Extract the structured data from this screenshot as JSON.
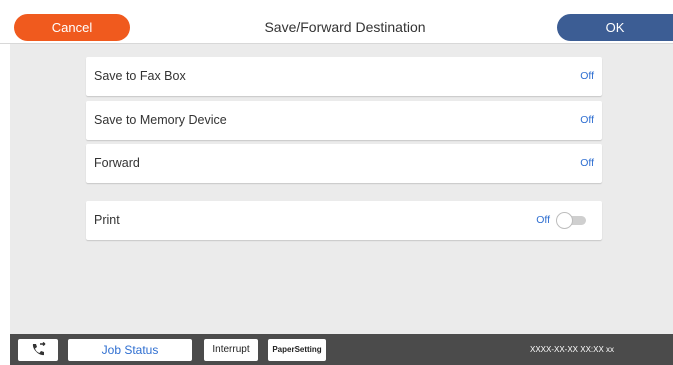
{
  "header": {
    "cancel_label": "Cancel",
    "title": "Save/Forward Destination",
    "ok_label": "OK"
  },
  "settings": [
    {
      "label": "Save to Fax Box",
      "value": "Off"
    },
    {
      "label": "Save to Memory Device",
      "value": "Off"
    },
    {
      "label": "Forward",
      "value": "Off"
    },
    {
      "label": "Print",
      "value": "Off",
      "toggle": "off"
    }
  ],
  "footer": {
    "fax_icon": "fax-call-icon",
    "job_status_label": "Job Status",
    "interrupt_label": "Interrupt",
    "paper_setting_label": "PaperSetting",
    "status_text": "XXXX-XX-XX XX:XX xx"
  },
  "colors": {
    "cancel": "#f05a1e",
    "ok": "#3c5d94",
    "value_text": "#2f6fd1",
    "footer_bg": "#4b4b4b"
  }
}
